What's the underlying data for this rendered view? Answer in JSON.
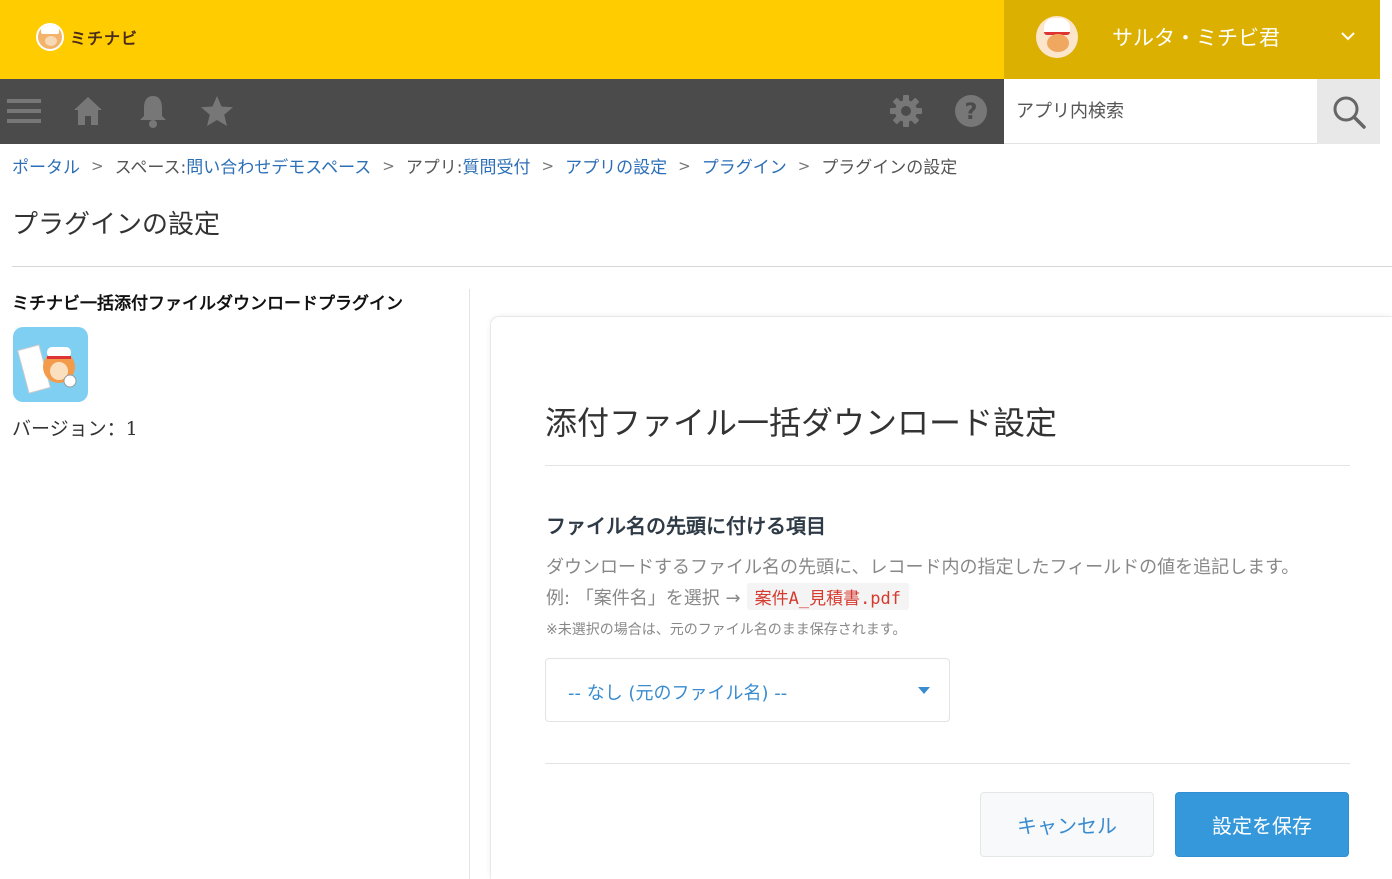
{
  "header": {
    "logo_text": "ミチナビ",
    "user_name": "サルタ・ミチビ君"
  },
  "navbar": {
    "icons": [
      "menu-icon",
      "home-icon",
      "bell-icon",
      "star-icon",
      "gear-icon",
      "help-icon"
    ],
    "search_placeholder": "アプリ内検索",
    "search_icon": "search-icon"
  },
  "breadcrumb": {
    "portal": "ポータル",
    "space_prefix": "スペース: ",
    "space_name": "問い合わせデモスペース",
    "app_prefix": "アプリ: ",
    "app_name": "質問受付",
    "app_settings": "アプリの設定",
    "plugins": "プラグイン",
    "current": "プラグインの設定",
    "separator": ">"
  },
  "page_title": "プラグインの設定",
  "plugin": {
    "name": "ミチナビ一括添付ファイルダウンロードプラグイン",
    "version_label": "バージョン：1"
  },
  "settings": {
    "title": "添付ファイル一括ダウンロード設定",
    "section_label": "ファイル名の先頭に付ける項目",
    "description": "ダウンロードするファイル名の先頭に、レコード内の指定したフィールドの値を追記します。",
    "example_prefix": "例: 「案件名」を選択 →",
    "example_code": "案件A_見積書.pdf",
    "note": "※未選択の場合は、元のファイル名のまま保存されます。",
    "select_value": "-- なし (元のファイル名) --",
    "cancel_label": "キャンセル",
    "save_label": "設定を保存"
  },
  "colors": {
    "header_yellow": "#ffcc00",
    "user_area": "#dcb000",
    "navbar": "#4b4b4b",
    "link_blue": "#2d6fb6",
    "primary_button": "#3498db",
    "code_red": "#d63a2f"
  }
}
